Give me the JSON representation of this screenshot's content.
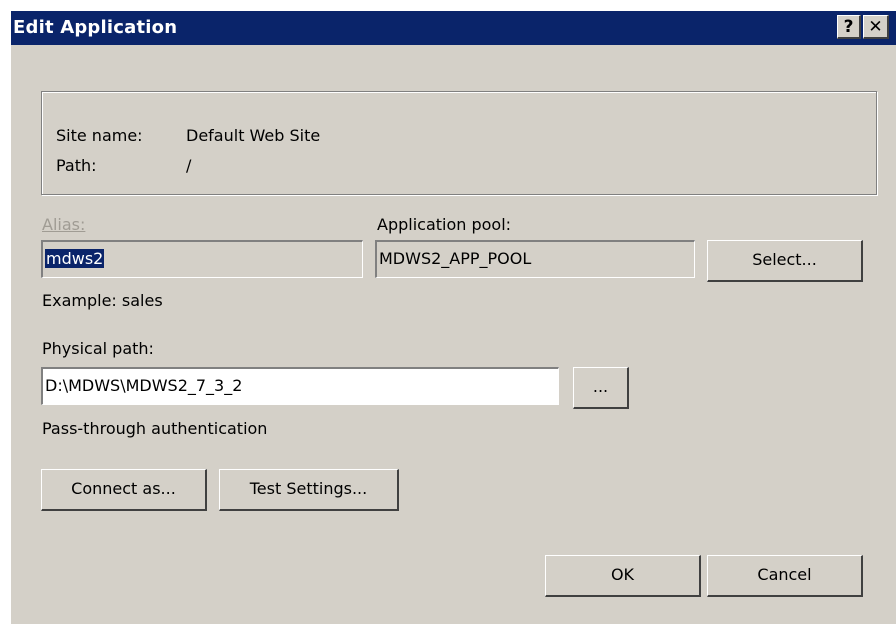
{
  "window": {
    "title": "Edit Application",
    "help_label": "?",
    "close_label": "✕"
  },
  "site_info": {
    "site_name_label": "Site name:",
    "site_name_value": "Default Web Site",
    "path_label": "Path:",
    "path_value": "/"
  },
  "alias": {
    "label": "Alias:",
    "value": "mdws2",
    "example": "Example: sales"
  },
  "app_pool": {
    "label": "Application pool:",
    "value": "MDWS2_APP_POOL",
    "select_button": "Select..."
  },
  "physical_path": {
    "label": "Physical path:",
    "value": "D:\\MDWS\\MDWS2_7_3_2",
    "browse_button": "..."
  },
  "auth": {
    "text": "Pass-through authentication",
    "connect_button": "Connect as...",
    "test_button": "Test Settings..."
  },
  "footer": {
    "ok_button": "OK",
    "cancel_button": "Cancel"
  }
}
